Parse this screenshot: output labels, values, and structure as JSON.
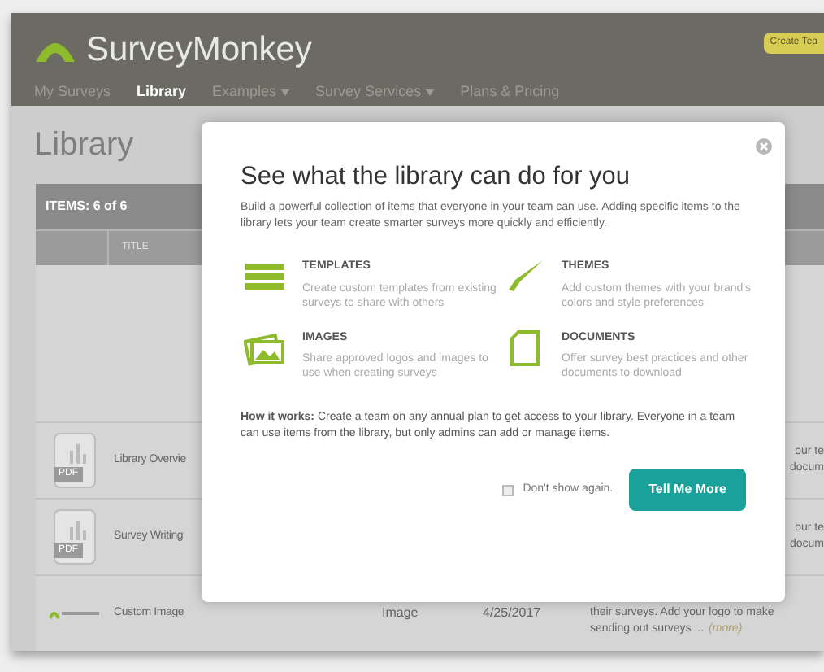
{
  "header": {
    "logo": "SurveyMonkey",
    "create_button": "Create Tea"
  },
  "nav": [
    {
      "label": "My Surveys",
      "selected": false,
      "dropdown": false
    },
    {
      "label": "Library",
      "selected": true,
      "dropdown": false
    },
    {
      "label": "Examples",
      "selected": false,
      "dropdown": true
    },
    {
      "label": "Survey Services",
      "selected": false,
      "dropdown": true
    },
    {
      "label": "Plans & Pricing",
      "selected": false,
      "dropdown": false
    }
  ],
  "page_title": "Library",
  "table": {
    "count_label": "ITEMS: 6 of 6",
    "columns": [
      "TITLE"
    ],
    "rows": [
      {
        "kind": "pdf",
        "badge": "PDF",
        "title": "Library Overvie",
        "description": [
          "our te",
          "docum"
        ]
      },
      {
        "kind": "pdf",
        "badge": "PDF",
        "title": "Survey Writing",
        "description": [
          "our te",
          "docum"
        ]
      },
      {
        "kind": "image",
        "title": "Custom Image",
        "type": "Image",
        "date": "4/25/2017",
        "description": [
          "their surveys. Add your logo to make",
          "sending out surveys ..."
        ],
        "more": "(more)"
      }
    ]
  },
  "modal": {
    "title": "See what the library can do for you",
    "intro": "Build a powerful collection of items that everyone in your team can use. Adding specific items to the library lets your team create smarter surveys more quickly and efficiently.",
    "features": [
      {
        "kind": "templates",
        "title": "TEMPLATES",
        "description": "Create custom templates from existing surveys to share with others"
      },
      {
        "kind": "themes",
        "title": "THEMES",
        "description": "Add custom themes with your brand's colors and style preferences"
      },
      {
        "kind": "images",
        "title": "IMAGES",
        "description": "Share approved logos and images to use when creating surveys"
      },
      {
        "kind": "documents",
        "title": "DOCUMENTS",
        "description": "Offer survey best practices and other documents to download"
      }
    ],
    "how_it_works": "**How it works:** Create a team on any annual plan to get access to your library. Everyone in a team can use items from the library, but only admins can add or manage items.",
    "dont_show": {
      "label": "Don't show again.",
      "checked": false
    },
    "button": "Tell Me More"
  }
}
